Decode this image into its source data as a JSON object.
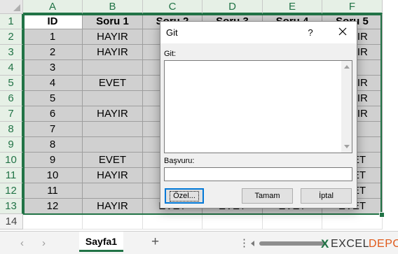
{
  "columns": [
    "A",
    "B",
    "C",
    "D",
    "E",
    "F"
  ],
  "rows": [
    "1",
    "2",
    "3",
    "4",
    "5",
    "6",
    "7",
    "8",
    "9",
    "10",
    "11",
    "12",
    "13",
    "14"
  ],
  "table": {
    "headers": [
      "ID",
      "Soru 1",
      "Soru 2",
      "Soru 3",
      "Soru 4",
      "Soru 5"
    ],
    "data": [
      [
        "1",
        "HAYIR",
        "",
        "",
        "",
        "HAYIR"
      ],
      [
        "2",
        "HAYIR",
        "",
        "",
        "",
        "HAYIR"
      ],
      [
        "3",
        "",
        "",
        "",
        "",
        ""
      ],
      [
        "4",
        "EVET",
        "",
        "",
        "",
        "HAYIR"
      ],
      [
        "5",
        "",
        "",
        "",
        "",
        "HAYIR"
      ],
      [
        "6",
        "HAYIR",
        "",
        "",
        "",
        "HAYIR"
      ],
      [
        "7",
        "",
        "",
        "",
        "",
        ""
      ],
      [
        "8",
        "",
        "",
        "",
        "",
        ""
      ],
      [
        "9",
        "EVET",
        "",
        "",
        "",
        "EVET"
      ],
      [
        "10",
        "HAYIR",
        "",
        "",
        "",
        "EVET"
      ],
      [
        "11",
        "",
        "",
        "",
        "",
        "EVET"
      ],
      [
        "12",
        "HAYIR",
        "EVET",
        "EVET",
        "EVET",
        "EVET"
      ]
    ]
  },
  "dialog": {
    "title": "Git",
    "help": "?",
    "goto_label": "Git:",
    "reference_label": "Başvuru:",
    "reference_value": "",
    "special_button": "Özel...",
    "ok_button": "Tamam",
    "cancel_button": "İptal"
  },
  "tabs": {
    "sheet_name": "Sayfa1",
    "add": "+",
    "more": "⋮",
    "prev": "‹",
    "next": "›"
  },
  "watermark": {
    "x": "X",
    "excel": "EXCEL",
    "depo": "DEPO"
  },
  "colors": {
    "accent": "#217346",
    "selection_fill": "#d0d0d0",
    "focus": "#0078d7",
    "logo_orange": "#e05a1b"
  }
}
